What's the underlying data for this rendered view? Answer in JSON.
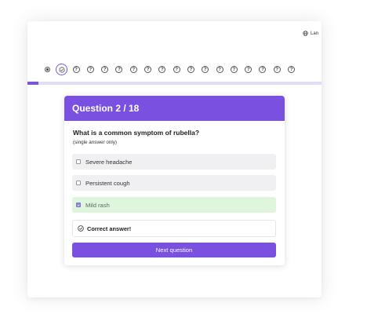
{
  "header": {
    "language_label": "Lan"
  },
  "progress": {
    "fraction": 0.036,
    "dots": [
      {
        "state": "visited",
        "glyph": ""
      },
      {
        "state": "current",
        "glyph": ""
      },
      {
        "state": "unanswered",
        "glyph": "?"
      },
      {
        "state": "unanswered",
        "glyph": "?"
      },
      {
        "state": "unanswered",
        "glyph": "?"
      },
      {
        "state": "unanswered",
        "glyph": "?"
      },
      {
        "state": "unanswered",
        "glyph": "?"
      },
      {
        "state": "unanswered",
        "glyph": "?"
      },
      {
        "state": "unanswered",
        "glyph": "?"
      },
      {
        "state": "unanswered",
        "glyph": "?"
      },
      {
        "state": "unanswered",
        "glyph": "?"
      },
      {
        "state": "unanswered",
        "glyph": "?"
      },
      {
        "state": "unanswered",
        "glyph": "?"
      },
      {
        "state": "unanswered",
        "glyph": "?"
      },
      {
        "state": "unanswered",
        "glyph": "?"
      },
      {
        "state": "unanswered",
        "glyph": "?"
      },
      {
        "state": "unanswered",
        "glyph": "?"
      },
      {
        "state": "unanswered",
        "glyph": "?"
      }
    ]
  },
  "quiz": {
    "header_title": "Question 2 / 18",
    "question": "What is a common symptom of rubella?",
    "hint": "(single answer only)",
    "options": [
      {
        "label": "Severe headache",
        "checked": false,
        "correct": false
      },
      {
        "label": "Persistent cough",
        "checked": false,
        "correct": false
      },
      {
        "label": "Mild rash",
        "checked": true,
        "correct": true
      }
    ],
    "feedback": "Correct answer!",
    "next_label": "Next question"
  },
  "colors": {
    "accent": "#7a50e0",
    "correct_bg": "#dff5dd",
    "progress_track": "#e3ddf3"
  },
  "icons": {
    "language": "globe-icon",
    "current_question": "check-circle-icon",
    "unanswered_question": "question-circle-icon",
    "feedback": "check-circle-icon",
    "option_checked": "check-icon"
  }
}
